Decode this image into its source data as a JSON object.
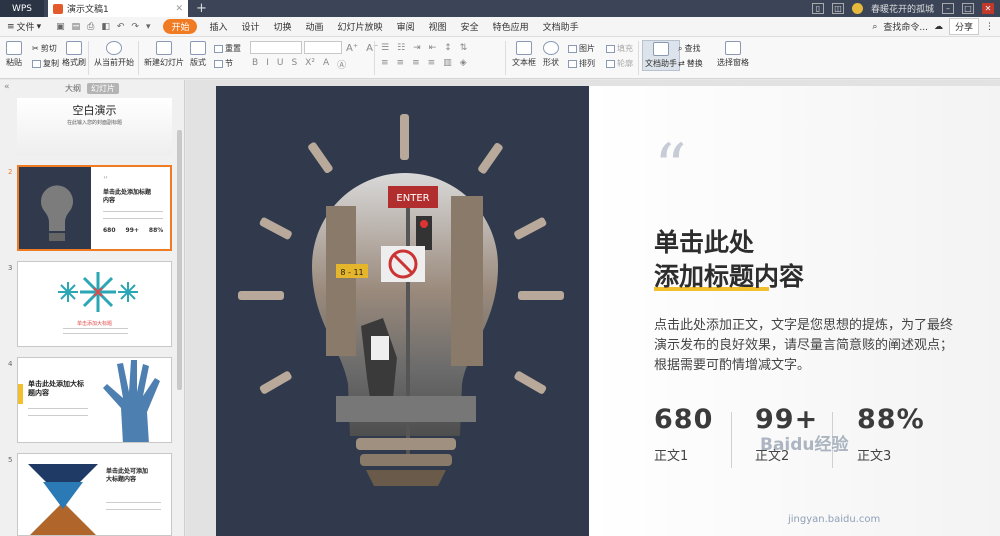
{
  "tabbar": {
    "app_label": "WPS",
    "doc_tab": "演示文稿1",
    "user_label": "春暖花开的孤城",
    "colors": {
      "tab_bg": "#3b4557",
      "accent": "#f07b23"
    }
  },
  "menu": {
    "file": "文件",
    "items": [
      "开始",
      "插入",
      "设计",
      "切换",
      "动画",
      "幻灯片放映",
      "审阅",
      "视图",
      "安全",
      "特色应用",
      "文档助手"
    ],
    "search": "查找命令...",
    "share": "分享"
  },
  "ribbon": {
    "paste": "粘贴",
    "cut": "剪切",
    "copy": "复制",
    "format_painter": "格式刷",
    "from_current": "从当前开始",
    "new_slide": "新建幻灯片",
    "layout": "版式",
    "reset": "重置",
    "section": "节",
    "textbox": "文本框",
    "shape": "形状",
    "picture": "图片",
    "fill": "填充",
    "arrange": "排列",
    "outline": "轮廓",
    "doc_helper": "文档助手",
    "find": "查找",
    "replace": "替换",
    "select_pane": "选择窗格"
  },
  "panel": {
    "tab_outline": "大纲",
    "tab_slides": "幻灯片",
    "thumbs": [
      {
        "num": "",
        "title": "空白演示",
        "subtitle": "在此输入您的封面副标题"
      },
      {
        "num": "2",
        "title": "单击此处添加标题内容",
        "stats": [
          "680",
          "99+",
          "88%"
        ]
      },
      {
        "num": "3",
        "title": "单击添加大标题"
      },
      {
        "num": "4",
        "title": "单击此处添加大标题内容"
      },
      {
        "num": "5",
        "title": "单击此处可添加大标题内容"
      }
    ]
  },
  "slide": {
    "quote_mark": "“",
    "title_line1": "单击此处",
    "title_line2": "添加标题内容",
    "body": "点击此处添加正文，文字是您思想的提炼，为了最终演示发布的良好效果，请尽量言简意赅的阐述观点；根据需要可酌情增减文字。",
    "stats": [
      {
        "value": "680",
        "label": "正文1"
      },
      {
        "value": "99+",
        "label": "正文2"
      },
      {
        "value": "88%",
        "label": "正文3"
      }
    ],
    "sign_enter": "ENTER",
    "sign_street": "8 - 11",
    "colors": {
      "dark_panel": "#303a4c",
      "highlight": "#f2c02d"
    }
  },
  "watermark": {
    "logo": "Baidu经验",
    "url": "jingyan.baidu.com"
  }
}
